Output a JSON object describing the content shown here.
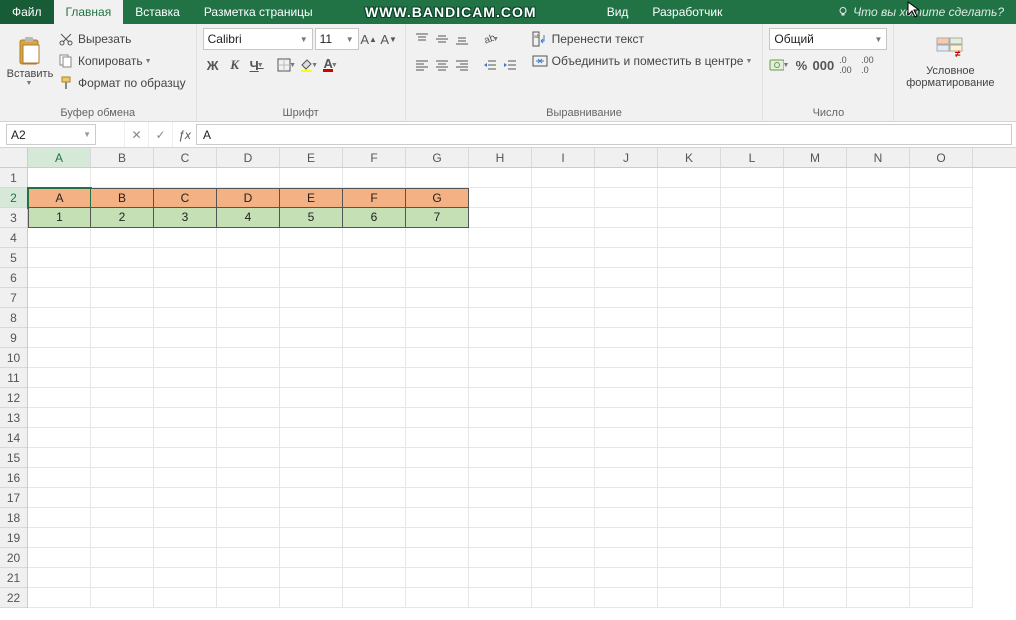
{
  "tabs": {
    "file": "Файл",
    "home": "Главная",
    "insert": "Вставка",
    "layout": "Разметка страницы",
    "view": "Вид",
    "developer": "Разработчик"
  },
  "watermark": "WWW.BANDICAM.COM",
  "tell_me": "Что вы хотите сделать?",
  "ribbon": {
    "clipboard": {
      "paste": "Вставить",
      "cut": "Вырезать",
      "copy": "Копировать",
      "format_painter": "Формат по образцу",
      "group_label": "Буфер обмена"
    },
    "font": {
      "name": "Calibri",
      "size": "11",
      "bold": "Ж",
      "italic": "К",
      "underline": "Ч",
      "group_label": "Шрифт"
    },
    "alignment": {
      "wrap": "Перенести текст",
      "merge": "Объединить и поместить в центре",
      "group_label": "Выравнивание"
    },
    "number": {
      "format": "Общий",
      "group_label": "Число"
    },
    "styles": {
      "cond_format_l1": "Условное",
      "cond_format_l2": "форматирование"
    }
  },
  "namebox": "A2",
  "formula": "A",
  "grid": {
    "columns": [
      "A",
      "B",
      "C",
      "D",
      "E",
      "F",
      "G",
      "H",
      "I",
      "J",
      "K",
      "L",
      "M",
      "N",
      "O"
    ],
    "rows": [
      1,
      2,
      3,
      4,
      5,
      6,
      7,
      8,
      9,
      10,
      11,
      12,
      13,
      14,
      15,
      16,
      17,
      18,
      19,
      20,
      21,
      22
    ],
    "row2": [
      "A",
      "B",
      "C",
      "D",
      "E",
      "F",
      "G"
    ],
    "row3": [
      "1",
      "2",
      "3",
      "4",
      "5",
      "6",
      "7"
    ],
    "selected_cell": "A2",
    "selected_col": "A",
    "selected_row": 2
  }
}
